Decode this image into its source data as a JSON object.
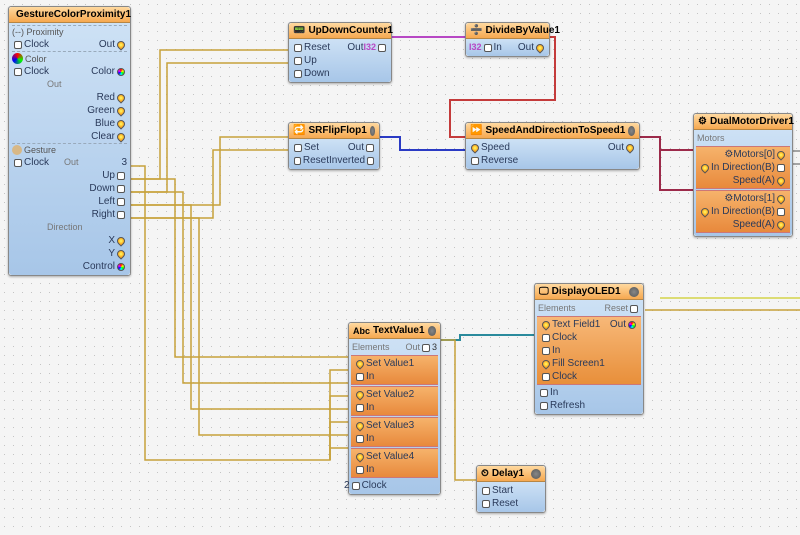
{
  "nodes": {
    "gesture": {
      "title": "GestureColorProximity1",
      "sections": {
        "proximity": "(--) Proximity",
        "color": "Color",
        "gesture": "Gesture",
        "direction": "Direction"
      },
      "pins": {
        "clock1": "Clock",
        "out1": "Out",
        "clock2": "Clock",
        "colorOut": "Color",
        "out2": "Out",
        "red": "Red",
        "green": "Green",
        "blue": "Blue",
        "clear": "Clear",
        "clock3": "Clock",
        "out3": "Out",
        "up": "Up",
        "down": "Down",
        "left": "Left",
        "right": "Right",
        "x": "X",
        "y": "Y",
        "control": "Control"
      },
      "count": "3"
    },
    "updown": {
      "title": "UpDownCounter1",
      "reset": "Reset",
      "up": "Up",
      "down": "Down",
      "out": "Out",
      "outType": "I32"
    },
    "divide": {
      "title": "DivideByValue1",
      "in": "In",
      "out": "Out",
      "inType": "I32"
    },
    "srff": {
      "title": "SRFlipFlop1",
      "set": "Set",
      "reset": "Reset",
      "out": "Out",
      "inverted": "Inverted"
    },
    "speed": {
      "title": "SpeedAndDirectionToSpeed1",
      "speed": "Speed",
      "reverse": "Reverse",
      "out": "Out"
    },
    "motor": {
      "title": "DualMotorDriver1",
      "motors": "Motors",
      "m0": "Motors[0]",
      "m1": "Motors[1]",
      "in": "In",
      "direction": "Direction(B)",
      "speedA": "Speed(A)"
    },
    "textvalue": {
      "title": "TextValue1",
      "elements": "Elements",
      "out": "Out",
      "sv1": "Set Value1",
      "sv2": "Set Value2",
      "sv3": "Set Value3",
      "sv4": "Set Value4",
      "in": "In",
      "clock": "Clock",
      "count": "2",
      "count3": "3"
    },
    "delay": {
      "title": "Delay1",
      "start": "Start",
      "reset": "Reset"
    },
    "oled": {
      "title": "DisplayOLED1",
      "elements": "Elements",
      "tf": "Text Field1",
      "clock": "Clock",
      "in": "In",
      "fill": "Fill Screen1",
      "refresh": "Refresh",
      "reset": "Reset",
      "out": "Out"
    }
  }
}
